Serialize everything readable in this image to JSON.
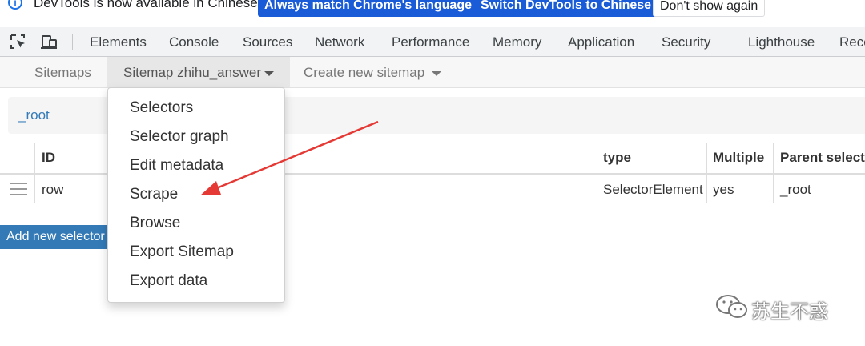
{
  "infobar": {
    "message": "DevTools is now available in Chinese!",
    "btn_match": "Always match Chrome's language",
    "btn_switch": "Switch DevTools to Chinese",
    "btn_dismiss": "Don't show again"
  },
  "devtools": {
    "icons": [
      "inspect-element-icon",
      "device-toolbar-icon"
    ],
    "tabs": [
      "Elements",
      "Console",
      "Sources",
      "Network",
      "Performance",
      "Memory",
      "Application",
      "Security",
      "Lighthouse",
      "Reco"
    ]
  },
  "webscraper": {
    "nav": {
      "sitemaps": "Sitemaps",
      "current_sitemap": "Sitemap zhihu_answer",
      "create": "Create new sitemap"
    },
    "breadcrumb": "_root",
    "table": {
      "headers": [
        "ID",
        "type",
        "Multiple",
        "Parent selecto"
      ],
      "rows": [
        {
          "id": "row",
          "type": "SelectorElement",
          "multiple": "yes",
          "parent": "_root"
        }
      ]
    },
    "add_selector": "Add new selector",
    "menu": [
      "Selectors",
      "Selector graph",
      "Edit metadata",
      "Scrape",
      "Browse",
      "Export Sitemap",
      "Export data"
    ]
  },
  "annotation": {
    "arrow_color": "#e53935"
  },
  "watermark": {
    "text": "苏生不惑"
  }
}
